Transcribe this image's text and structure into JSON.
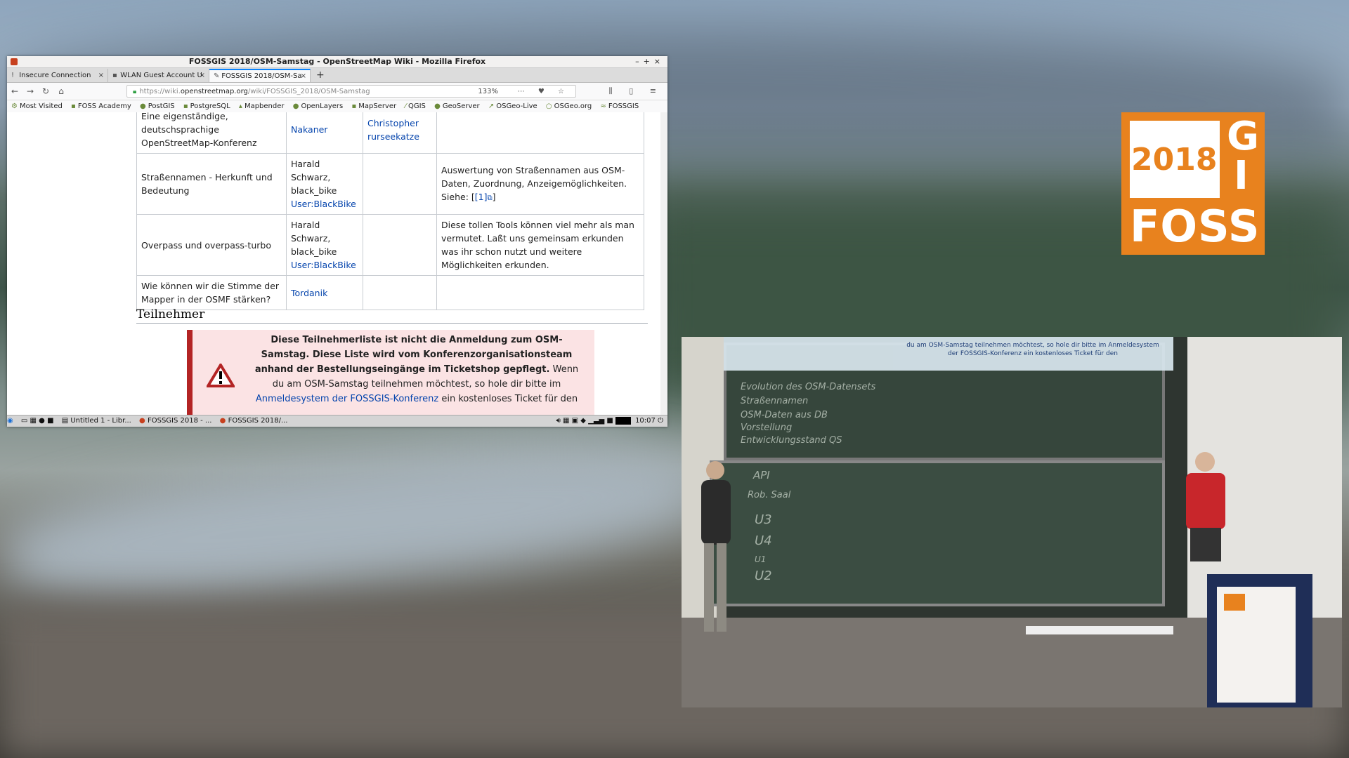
{
  "browser": {
    "window_title": "FOSSGIS 2018/OSM-Samstag - OpenStreetMap Wiki - Mozilla Firefox",
    "tabs": [
      {
        "label": "Insecure Connection",
        "active": false
      },
      {
        "label": "WLAN Guest Account U",
        "active": false
      },
      {
        "label": "FOSSGIS 2018/OSM-Sa",
        "active": true
      }
    ],
    "url_prefix": "https://wiki.",
    "url_host": "openstreetmap.org",
    "url_path": "/wiki/FOSSGIS_2018/OSM-Samstag",
    "zoom": "133%",
    "bookmarks": [
      "Most Visited",
      "FOSS Academy",
      "PostGIS",
      "PostgreSQL",
      "Mapbender",
      "OpenLayers",
      "MapServer",
      "QGIS",
      "GeoServer",
      "OSGeo-Live",
      "OSGeo.org",
      "FOSSGIS"
    ]
  },
  "wiki": {
    "rows": [
      {
        "topic": "Eine eigenständige, deutschsprachige OpenStreetMap-Konferenz",
        "speaker": "",
        "speaker_link": "Nakaner",
        "contact_link": "Christopher rurseekatze",
        "description": ""
      },
      {
        "topic": "Straßennamen - Herkunft und Bedeutung",
        "speaker": "Harald Schwarz, black_bike",
        "speaker_link": "User:BlackBike",
        "contact_link": "",
        "description": "Auswertung von Straßennamen aus OSM-Daten, Zuordnung, Anzeigemöglichkeiten. Siehe: ",
        "ref": "[1]"
      },
      {
        "topic": "Overpass und overpass-turbo",
        "speaker": "Harald Schwarz, black_bike",
        "speaker_link": "User:BlackBike",
        "contact_link": "",
        "description": "Diese tollen Tools können viel mehr als man vermutet. Laßt uns gemeinsam erkunden was ihr schon nutzt und weitere Möglichkeiten erkunden."
      },
      {
        "topic": "Wie können wir die Stimme der Mapper in der OSMF stärken?",
        "speaker": "",
        "speaker_link": "Tordanik",
        "contact_link": "",
        "description": ""
      }
    ],
    "section_heading": "Teilnehmer",
    "notice_bold": "Diese Teilnehmerliste ist nicht die Anmeldung zum OSM-Samstag. Diese Liste wird vom Konferenzorganisationsteam anhand der Bestellungseingänge im Ticketshop gepflegt.",
    "notice_text": " Wenn du am OSM-Samstag teilnehmen möchtest, so hole dir bitte im ",
    "notice_link": "Anmeldesystem der FOSSGIS-Konferenz",
    "notice_tail": " ein kostenloses Ticket für den"
  },
  "taskbar": {
    "items": [
      "Untitled 1 - Libr...",
      "FOSSGIS 2018 - ...",
      "FOSSGIS 2018/..."
    ],
    "clock": "10:07"
  },
  "logo": {
    "year": "2018",
    "letters_g": "G",
    "letters_i": "I",
    "word": "FOSS"
  },
  "video": {
    "projection_text": "du am OSM-Samstag teilnehmen möchtest, so hole dir bitte im Anmeldesystem der FOSSGIS-Konferenz ein kostenloses Ticket für den",
    "chalk_lines": [
      "Evolution des OSM-Datensets",
      "Straßennamen",
      "OSM-Daten aus DB",
      "Vorstellung",
      "Entwicklungsstand QS",
      "API",
      "Rob. Saal",
      "U3",
      "U4",
      "U1",
      "U2"
    ]
  },
  "colors": {
    "logo_orange": "#e8821e",
    "link_blue": "#0645ad",
    "warn_red": "#b32424",
    "warn_bg": "#fbe3e4"
  }
}
